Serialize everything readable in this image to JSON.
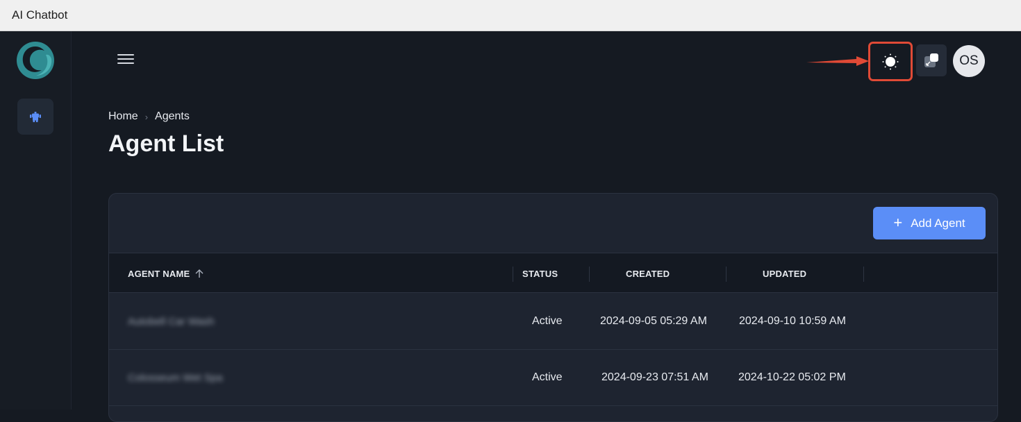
{
  "window": {
    "title": "AI Chatbot"
  },
  "breadcrumb": {
    "home": "Home",
    "current": "Agents"
  },
  "page": {
    "title": "Agent List"
  },
  "toolbar": {
    "add_label": "Add Agent",
    "add_icon": "plus-icon"
  },
  "header": {
    "avatar_initials": "OS",
    "theme_icon": "sun-icon",
    "expand_icon": "expand-icon",
    "menu_icon": "hamburger-icon"
  },
  "table": {
    "columns": {
      "name": "AGENT NAME",
      "status": "STATUS",
      "created": "CREATED",
      "updated": "UPDATED"
    },
    "sort_icon": "arrow-up-icon",
    "rows": [
      {
        "name": "Autobell Car Wash",
        "status": "Active",
        "created": "2024-09-05 05:29 AM",
        "updated": "2024-09-10 10:59 AM"
      },
      {
        "name": "Colosseum Wet Spa",
        "status": "Active",
        "created": "2024-09-23 07:51 AM",
        "updated": "2024-10-22 05:02 PM"
      }
    ]
  },
  "colors": {
    "accent": "#5b8ef7",
    "highlight": "#e04a36",
    "background": "#151a22",
    "card": "#1e2430"
  }
}
